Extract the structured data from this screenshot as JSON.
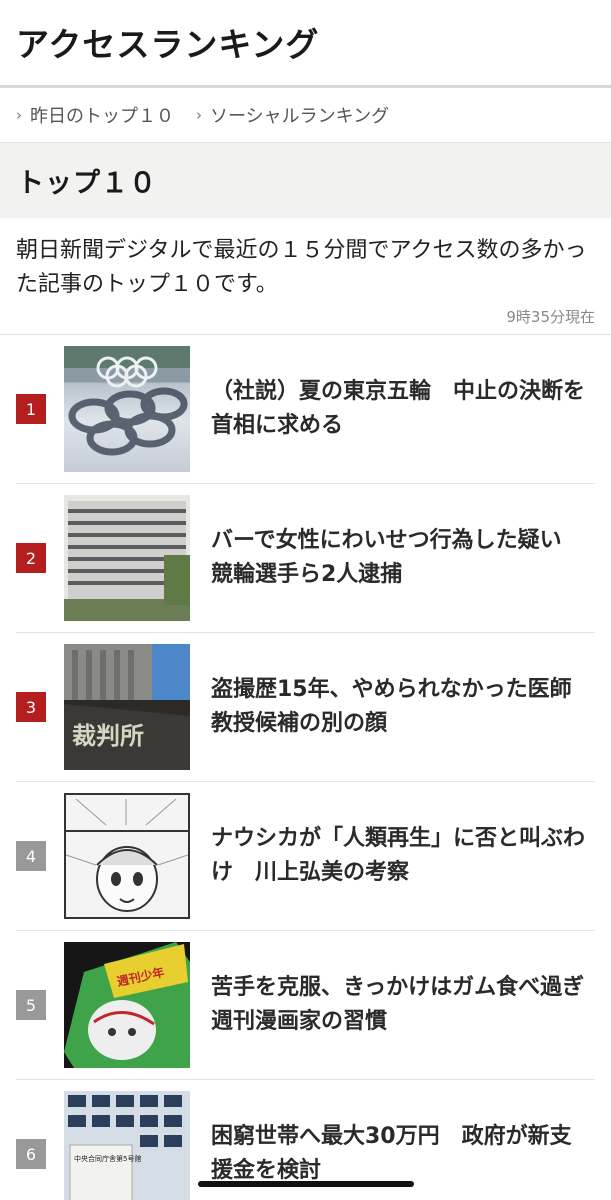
{
  "header": {
    "title": "アクセスランキング"
  },
  "breadcrumb": [
    {
      "label": "昨日のトップ１０"
    },
    {
      "label": "ソーシャルランキング"
    }
  ],
  "section": {
    "title": "トップ１０"
  },
  "description": "朝日新聞デジタルで最近の１５分間でアクセス数の多かった記事のトップ１０です。",
  "updated": "9時35分現在",
  "ranking": [
    {
      "rank": "1",
      "title": "（社説）夏の東京五輪　中止の決断を首相に求める"
    },
    {
      "rank": "2",
      "title": "バーで女性にわいせつ行為した疑い　競輪選手ら2人逮捕"
    },
    {
      "rank": "3",
      "title": "盗撮歴15年、やめられなかった医師　教授候補の別の顔"
    },
    {
      "rank": "4",
      "title": "ナウシカが「人類再生」に否と叫ぶわけ　川上弘美の考察"
    },
    {
      "rank": "5",
      "title": "苦手を克服、きっかけはガム食べ過ぎ　週刊漫画家の習慣"
    },
    {
      "rank": "6",
      "title": "困窮世帯へ最大30万円　政府が新支援金を検討"
    }
  ],
  "colors": {
    "top_rank": "#b51e1e",
    "rest_rank": "#999999"
  },
  "thumb_text": {
    "court_sign": "裁判所",
    "comic_cover": "週刊少年",
    "building_sign": "中央合同庁舎第5号館"
  }
}
